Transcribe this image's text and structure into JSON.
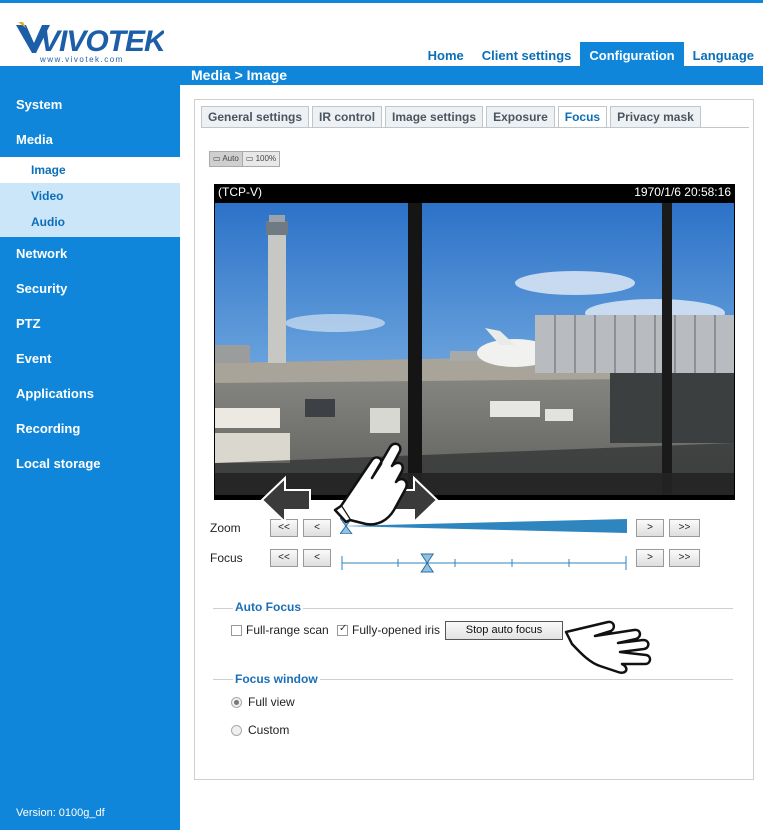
{
  "header": {
    "logo_text": "VIVOTEK",
    "logo_url_text": "www.vivotek.com",
    "nav": [
      {
        "label": "Home",
        "active": false
      },
      {
        "label": "Client settings",
        "active": false
      },
      {
        "label": "Configuration",
        "active": true
      },
      {
        "label": "Language",
        "active": false
      }
    ]
  },
  "page_title": "Media  > Image",
  "sidebar": {
    "items": [
      {
        "label": "System"
      },
      {
        "label": "Media"
      },
      {
        "label": "Network"
      },
      {
        "label": "Security"
      },
      {
        "label": "PTZ"
      },
      {
        "label": "Event"
      },
      {
        "label": "Applications"
      },
      {
        "label": "Recording"
      },
      {
        "label": "Local storage"
      }
    ],
    "subitems": [
      {
        "label": "Image",
        "active": true
      },
      {
        "label": "Video",
        "active": false
      },
      {
        "label": "Audio",
        "active": false
      }
    ],
    "version": "Version: 0100g_df"
  },
  "tabs": [
    {
      "label": "General settings",
      "active": false
    },
    {
      "label": "IR control",
      "active": false
    },
    {
      "label": "Image settings",
      "active": false
    },
    {
      "label": "Exposure",
      "active": false
    },
    {
      "label": "Focus",
      "active": true
    },
    {
      "label": "Privacy mask",
      "active": false
    }
  ],
  "view_toggle": {
    "auto": "Auto",
    "full": "100%"
  },
  "video": {
    "name": "(TCP-V)",
    "timestamp": "1970/1/6 20:58:16"
  },
  "zoom": {
    "label": "Zoom",
    "btn_far_left": "<<",
    "btn_left": "<",
    "btn_right": ">",
    "btn_far_right": ">>",
    "level": 0.0
  },
  "focus": {
    "label": "Focus",
    "btn_far_left": "<<",
    "btn_left": "<",
    "btn_right": ">",
    "btn_far_right": ">>",
    "level": 0.3
  },
  "auto_focus": {
    "title": "Auto Focus",
    "full_range_label": "Full-range scan",
    "full_range_checked": false,
    "iris_label": "Fully-opened iris",
    "iris_checked": true,
    "stop_button": "Stop auto focus"
  },
  "focus_window": {
    "title": "Focus window",
    "options": [
      {
        "label": "Full view",
        "selected": true
      },
      {
        "label": "Custom",
        "selected": false
      }
    ]
  },
  "colors": {
    "brand_blue": "#0f86d9",
    "sub_bg": "#cbe6f8",
    "link_blue": "#0b6fb8",
    "slider_blue": "#2f86bf"
  }
}
